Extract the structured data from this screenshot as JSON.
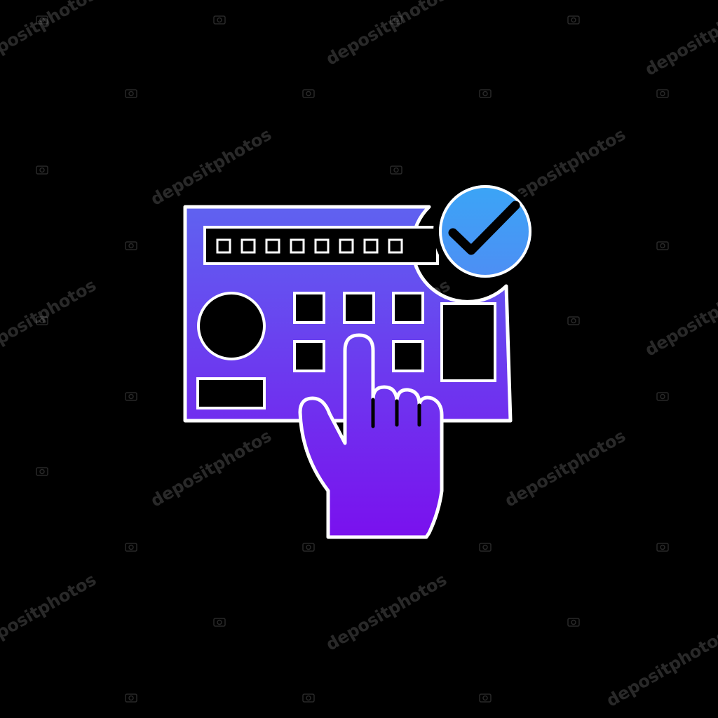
{
  "watermark": {
    "text": "depositphotos"
  },
  "icon": {
    "name": "control-panel-touch-check",
    "gradient_top": "#3aa0f5",
    "gradient_bottom": "#7a10ee",
    "outline": "#ffffff",
    "background": "#000000",
    "display_slots": 8
  }
}
